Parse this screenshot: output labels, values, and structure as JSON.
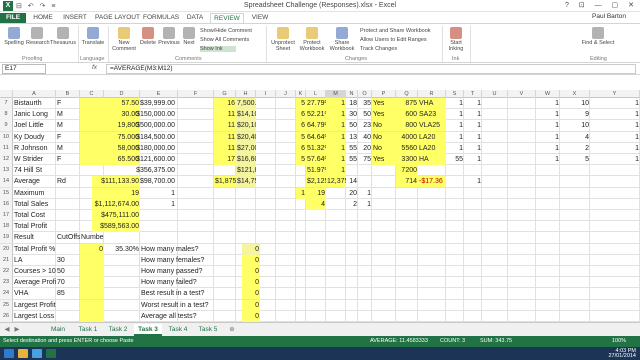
{
  "window": {
    "title": "Spreadsheet Challenge (Responses).xlsx - Excel",
    "app_icon": "X",
    "controls": "? ⊡ — ▢ ✕"
  },
  "qat": "⊟ ↶ ↷ ≡",
  "tabs": [
    "FILE",
    "HOME",
    "INSERT",
    "PAGE LAYOUT",
    "FORMULAS",
    "DATA",
    "REVIEW",
    "VIEW"
  ],
  "active_tab": "REVIEW",
  "user": "Paul Barton",
  "ribbon": {
    "buttons": [
      "Spelling",
      "Research",
      "Thesaurus",
      "Translate",
      "New Comment",
      "Delete",
      "Previous",
      "Next",
      "Show Ink",
      "Unprotect Sheet",
      "Protect Workbook",
      "Share Workbook",
      "Start Inking",
      "Find & Select"
    ],
    "comments_items": [
      "Show/Hide Comment",
      "Show All Comments"
    ],
    "changes_items": [
      "Protect and Share Workbook",
      "Allow Users to Edit Ranges",
      "Track Changes"
    ],
    "groups": [
      "Proofing",
      "Language",
      "Comments",
      "Changes",
      "Ink",
      "Editing"
    ]
  },
  "formula_bar": {
    "name_box": "E17",
    "fx": "fx",
    "formula": "=AVERAGE(M3:M12)"
  },
  "columns": [
    "A",
    "B",
    "C",
    "D",
    "E",
    "F",
    "G",
    "H",
    "I",
    "J",
    "K",
    "L",
    "M",
    "N",
    "O",
    "P",
    "Q",
    "R",
    "S",
    "T",
    "U",
    "V",
    "W",
    "X",
    "Y"
  ],
  "rows": [
    {
      "n": "7",
      "a": "Bistaurth",
      "b": "F",
      "c": "25",
      "c2": "57.50",
      "d": "$39,999.00",
      "g": "16",
      "h": "7,500.00",
      "k": "5",
      "l": "27.79%",
      "m": "1",
      "n2": "18",
      "o": "35",
      "p": "Yes",
      "q": "875",
      "r": "VHA",
      "s": "1",
      "t": "1",
      "w": "1",
      "x": "10",
      "y": "1"
    },
    {
      "n": "8",
      "a": "Janic Long",
      "b": "M",
      "c": "55",
      "c2": "30.00",
      "d": "$150,000.00",
      "g": "11",
      "h": "$14,100.00",
      "k": "6",
      "l": "52.21%",
      "m": "1",
      "n2": "30",
      "o": "50",
      "p": "Yes",
      "q": "600",
      "r": "SA23",
      "s": "1",
      "t": "1",
      "w": "1",
      "x": "9",
      "y": "1"
    },
    {
      "n": "9",
      "a": "Joel Little",
      "b": "M",
      "c": "85",
      "c2": "19,800",
      "d": "$500,000.00",
      "g": "11",
      "h": "$20,100.00",
      "k": "6",
      "l": "64.79%",
      "m": "1",
      "n2": "50",
      "o": "23",
      "p": "No",
      "q": "800",
      "r": "VLA25",
      "s": "1",
      "t": "1",
      "w": "1",
      "x": "10",
      "y": "1"
    },
    {
      "n": "10",
      "a": "Ky Doudy",
      "b": "F",
      "c": "71",
      "c2": "75.000",
      "d": "$184,500.00",
      "g": "11",
      "h": "$20,400.00",
      "k": "5",
      "l": "64.64%",
      "m": "1",
      "n2": "13",
      "o": "40",
      "p": "No",
      "q": "4000",
      "r": "LA20",
      "s": "1",
      "t": "1",
      "w": "1",
      "x": "4",
      "y": "1"
    },
    {
      "n": "11",
      "a": "R Johnson",
      "b": "M",
      "c": "61",
      "c2": "58,000",
      "d": "$180,000.00",
      "g": "11",
      "h": "$27,000.00",
      "k": "6",
      "l": "51.32%",
      "m": "1",
      "n2": "55",
      "o": "20",
      "p": "No",
      "q": "5560",
      "r": "LA20",
      "s": "1",
      "t": "1",
      "w": "1",
      "x": "2",
      "y": "1"
    },
    {
      "n": "12",
      "a": "W Strider",
      "b": "F",
      "c": "55",
      "c2": "65.500",
      "d": "$121,600.00",
      "g": "17",
      "h": "$16,600.00",
      "k": "5",
      "l": "57.64%",
      "m": "1",
      "n2": "55",
      "o": "75",
      "p": "Yes",
      "q": "3300",
      "r": "HA",
      "s": "55",
      "t": "1",
      "w": "1",
      "x": "5",
      "y": "1"
    },
    {
      "n": "13",
      "a": "74 Hill St",
      "b": "",
      "c": "",
      "c2": "",
      "d": "$356,375.00",
      "g": "",
      "h": "$121,875.00",
      "k": "",
      "l": "51.97%",
      "m": "1",
      "n2": "",
      "o": "",
      "p": "",
      "q": "7200",
      "r": "",
      "s": "",
      "t": "",
      "w": "",
      "x": "",
      "y": ""
    },
    {
      "n": "14",
      "a": "Average",
      "b": "Rd",
      "c": "",
      "c2": "$111,133.90",
      "d": "$98,700.00",
      "g": "$1,875",
      "h": "$14,750.00",
      "k": "",
      "l": "$2,125",
      "m": "12,375",
      "n2": "14",
      "o": "",
      "p": "",
      "q": "714",
      "r": "-$17.36",
      "s": "",
      "t": "1",
      "w": "",
      "x": "",
      "y": ""
    },
    {
      "n": "15",
      "a": "Maximum",
      "b": "",
      "c": "",
      "c2": "19",
      "d": "1",
      "g": "",
      "h": "",
      "k": "1",
      "l": "19",
      "m": "",
      "n2": "20",
      "o": "1",
      "p": "",
      "q": "",
      "r": "",
      "s": "",
      "t": "",
      "w": "",
      "x": "",
      "y": ""
    },
    {
      "n": "16",
      "a": "Total Sales",
      "b": "",
      "c": "",
      "c2": "$1,112,674.00",
      "d": "1",
      "g": "",
      "h": "",
      "k": "",
      "l": "4",
      "m": "",
      "n2": "2",
      "o": "1",
      "p": "",
      "q": "",
      "r": "",
      "s": "",
      "t": "",
      "w": "",
      "x": "",
      "y": ""
    },
    {
      "n": "17",
      "a": "Total Cost",
      "b": "",
      "c": "",
      "c2": "$475,111.00",
      "d": "",
      "g": "",
      "h": "",
      "k": "",
      "l": "",
      "m": "",
      "n2": "",
      "o": "",
      "p": "",
      "q": "",
      "r": "",
      "s": "",
      "t": "",
      "w": "",
      "x": "",
      "y": ""
    },
    {
      "n": "18",
      "a": "Total Profit",
      "b": "",
      "c": "",
      "c2": "$589,563.00",
      "d": "",
      "g": "",
      "h": "",
      "k": "",
      "l": "",
      "m": "",
      "n2": "",
      "o": "",
      "p": "",
      "q": "",
      "r": "",
      "s": "",
      "t": "",
      "w": "",
      "x": "",
      "y": ""
    },
    {
      "n": "19",
      "a": "Result",
      "b": "CutOffs",
      "c": "Number",
      "c2": "",
      "d": "",
      "g": "",
      "h": "",
      "k": "",
      "l": "",
      "m": "",
      "n2": "",
      "o": "",
      "p": "",
      "q": "",
      "r": "",
      "s": "",
      "t": "",
      "w": "",
      "x": "",
      "y": ""
    },
    {
      "n": "20",
      "a": "Total Profit %",
      "b": "",
      "c": "0",
      "c2": "35.30%",
      "d": "How many males?",
      "g": "",
      "h": "0",
      "k": "",
      "l": "",
      "m": "",
      "n2": "",
      "o": "",
      "p": "",
      "q": "",
      "r": "",
      "s": "",
      "t": "",
      "w": "",
      "x": "",
      "y": ""
    },
    {
      "n": "21",
      "a": "LA",
      "b": "30",
      "c": "",
      "c2": "",
      "d": "How many females?",
      "g": "",
      "h": "0",
      "k": "",
      "l": "",
      "m": "",
      "n2": "",
      "o": "",
      "p": "",
      "q": "",
      "r": "",
      "s": "",
      "t": "",
      "w": "",
      "x": "",
      "y": ""
    },
    {
      "n": "22",
      "a": "Courses > 1000m",
      "b": "50",
      "c": "",
      "c2": "",
      "d": "How many passed?",
      "g": "",
      "h": "0",
      "k": "",
      "l": "",
      "m": "",
      "n2": "",
      "o": "",
      "p": "",
      "q": "",
      "r": "",
      "s": "",
      "t": "",
      "w": "",
      "x": "",
      "y": ""
    },
    {
      "n": "23",
      "a": "Average Profit",
      "b": "70",
      "c": "",
      "c2": "",
      "d": "How many failed?",
      "g": "",
      "h": "0",
      "k": "",
      "l": "",
      "m": "",
      "n2": "",
      "o": "",
      "p": "",
      "q": "",
      "r": "",
      "s": "",
      "t": "",
      "w": "",
      "x": "",
      "y": ""
    },
    {
      "n": "24",
      "a": "VHA",
      "b": "85",
      "c": "",
      "c2": "",
      "d": "Best result in a test?",
      "g": "",
      "h": "0",
      "k": "",
      "l": "",
      "m": "",
      "n2": "",
      "o": "",
      "p": "",
      "q": "",
      "r": "",
      "s": "",
      "t": "",
      "w": "",
      "x": "",
      "y": ""
    },
    {
      "n": "25",
      "a": "Largest Profit",
      "b": "",
      "c": "",
      "c2": "",
      "d": "Worst result in a test?",
      "g": "",
      "h": "0",
      "k": "",
      "l": "",
      "m": "",
      "n2": "",
      "o": "",
      "p": "",
      "q": "",
      "r": "",
      "s": "",
      "t": "",
      "w": "",
      "x": "",
      "y": ""
    },
    {
      "n": "26",
      "a": "Largest Loss",
      "b": "",
      "c": "",
      "c2": "",
      "d": "Average all tests?",
      "g": "",
      "h": "0",
      "k": "",
      "l": "",
      "m": "",
      "n2": "",
      "o": "",
      "p": "",
      "q": "",
      "r": "",
      "s": "",
      "t": "",
      "w": "",
      "x": "",
      "y": ""
    }
  ],
  "sheets": [
    "Main",
    "Task 1",
    "Task 2",
    "Task 3",
    "Task 4",
    "Task 5"
  ],
  "active_sheet": "Task 3",
  "status": {
    "left": "Select destination and press ENTER or choose Paste",
    "average": "AVERAGE: 11.4583333",
    "count": "COUNT: 3",
    "sum": "SUM: 343.75",
    "zoom": "100%"
  },
  "clock": {
    "time": "4:03 PM",
    "date": "27/01/2014"
  }
}
